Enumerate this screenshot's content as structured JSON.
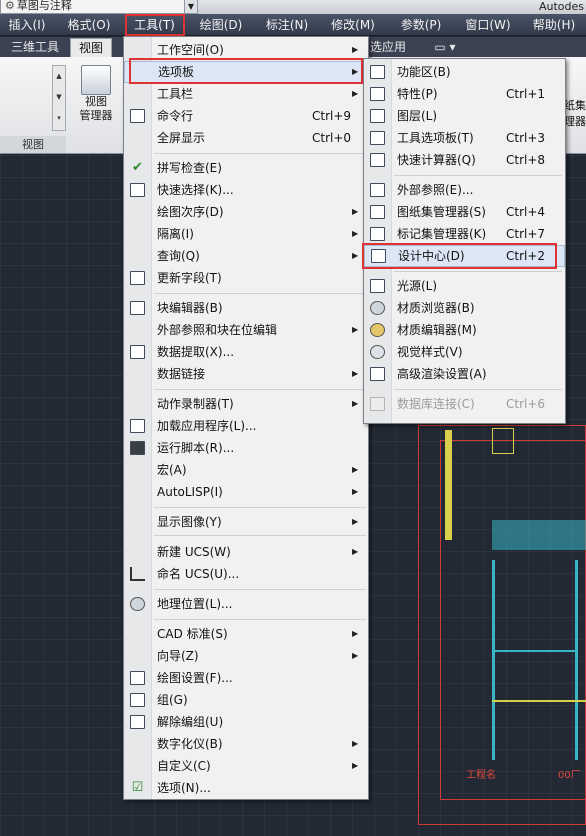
{
  "window": {
    "workspace": "草图与注释",
    "app_title": "Autodes"
  },
  "menubar": {
    "items": [
      "插入(I)",
      "格式(O)",
      "工具(T)",
      "绘图(D)",
      "标注(N)",
      "修改(M)",
      "参数(P)",
      "窗口(W)",
      "帮助(H)"
    ]
  },
  "ribbon": {
    "tabs": [
      "三维工具",
      "视图",
      "选应用"
    ],
    "button_label_1": "视图",
    "button_label_2": "管理器",
    "group_label": "视图",
    "right_label": "纸集",
    "right_label_2": "理器"
  },
  "tools_menu": {
    "items": [
      {
        "label": "工作空间(O)",
        "shortcut": "",
        "submenu": true
      },
      {
        "label": "选项板",
        "shortcut": "",
        "submenu": true
      },
      {
        "label": "工具栏",
        "shortcut": "",
        "submenu": true
      },
      {
        "label": "命令行",
        "shortcut": "Ctrl+9",
        "submenu": false
      },
      {
        "label": "全屏显示",
        "shortcut": "Ctrl+0",
        "submenu": false
      },
      {
        "label": "拼写检查(E)",
        "shortcut": "",
        "submenu": false
      },
      {
        "label": "快速选择(K)...",
        "shortcut": "",
        "submenu": false
      },
      {
        "label": "绘图次序(D)",
        "shortcut": "",
        "submenu": true
      },
      {
        "label": "隔离(I)",
        "shortcut": "",
        "submenu": true
      },
      {
        "label": "查询(Q)",
        "shortcut": "",
        "submenu": true
      },
      {
        "label": "更新字段(T)",
        "shortcut": "",
        "submenu": false
      },
      {
        "label": "块编辑器(B)",
        "shortcut": "",
        "submenu": false
      },
      {
        "label": "外部参照和块在位编辑",
        "shortcut": "",
        "submenu": true
      },
      {
        "label": "数据提取(X)...",
        "shortcut": "",
        "submenu": false
      },
      {
        "label": "数据链接",
        "shortcut": "",
        "submenu": true
      },
      {
        "label": "动作录制器(T)",
        "shortcut": "",
        "submenu": true
      },
      {
        "label": "加载应用程序(L)...",
        "shortcut": "",
        "submenu": false
      },
      {
        "label": "运行脚本(R)...",
        "shortcut": "",
        "submenu": false
      },
      {
        "label": "宏(A)",
        "shortcut": "",
        "submenu": true
      },
      {
        "label": "AutoLISP(I)",
        "shortcut": "",
        "submenu": true
      },
      {
        "label": "显示图像(Y)",
        "shortcut": "",
        "submenu": true
      },
      {
        "label": "新建 UCS(W)",
        "shortcut": "",
        "submenu": true
      },
      {
        "label": "命名 UCS(U)...",
        "shortcut": "",
        "submenu": false
      },
      {
        "label": "地理位置(L)...",
        "shortcut": "",
        "submenu": false
      },
      {
        "label": "CAD 标准(S)",
        "shortcut": "",
        "submenu": true
      },
      {
        "label": "向导(Z)",
        "shortcut": "",
        "submenu": true
      },
      {
        "label": "绘图设置(F)...",
        "shortcut": "",
        "submenu": false
      },
      {
        "label": "组(G)",
        "shortcut": "",
        "submenu": false
      },
      {
        "label": "解除编组(U)",
        "shortcut": "",
        "submenu": false
      },
      {
        "label": "数字化仪(B)",
        "shortcut": "",
        "submenu": true
      },
      {
        "label": "自定义(C)",
        "shortcut": "",
        "submenu": true
      },
      {
        "label": "选项(N)...",
        "shortcut": "",
        "submenu": false
      }
    ]
  },
  "palettes_submenu": {
    "items": [
      {
        "label": "功能区(B)",
        "shortcut": ""
      },
      {
        "label": "特性(P)",
        "shortcut": "Ctrl+1"
      },
      {
        "label": "图层(L)",
        "shortcut": ""
      },
      {
        "label": "工具选项板(T)",
        "shortcut": "Ctrl+3"
      },
      {
        "label": "快速计算器(Q)",
        "shortcut": "Ctrl+8"
      },
      {
        "label": "外部参照(E)...",
        "shortcut": ""
      },
      {
        "label": "图纸集管理器(S)",
        "shortcut": "Ctrl+4"
      },
      {
        "label": "标记集管理器(K)",
        "shortcut": "Ctrl+7"
      },
      {
        "label": "设计中心(D)",
        "shortcut": "Ctrl+2"
      },
      {
        "label": "光源(L)",
        "shortcut": ""
      },
      {
        "label": "材质浏览器(B)",
        "shortcut": ""
      },
      {
        "label": "材质编辑器(M)",
        "shortcut": ""
      },
      {
        "label": "视觉样式(V)",
        "shortcut": ""
      },
      {
        "label": "高级渲染设置(A)",
        "shortcut": ""
      },
      {
        "label": "数据库连接(C)",
        "shortcut": "Ctrl+6"
      }
    ]
  },
  "canvas": {
    "label_1": "工程名",
    "label_2": "00厂"
  },
  "colors": {
    "highlight_box": "#e03232",
    "menubar": "#3a4356",
    "canvas": "#222834"
  }
}
